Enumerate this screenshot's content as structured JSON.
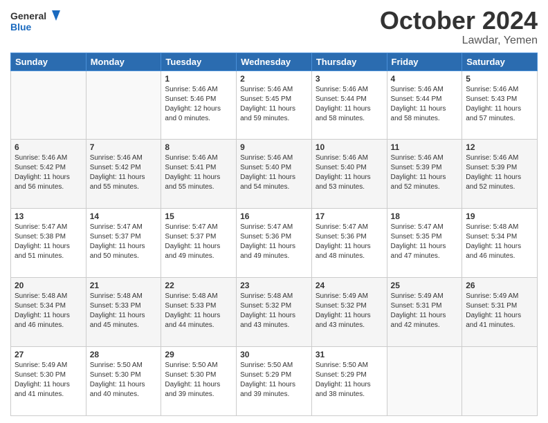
{
  "header": {
    "logo": {
      "general": "General",
      "blue": "Blue"
    },
    "title": "October 2024",
    "location": "Lawdar, Yemen"
  },
  "weekdays": [
    "Sunday",
    "Monday",
    "Tuesday",
    "Wednesday",
    "Thursday",
    "Friday",
    "Saturday"
  ],
  "weeks": [
    [
      {
        "day": "",
        "sunrise": "",
        "sunset": "",
        "daylight": ""
      },
      {
        "day": "",
        "sunrise": "",
        "sunset": "",
        "daylight": ""
      },
      {
        "day": "1",
        "sunrise": "Sunrise: 5:46 AM",
        "sunset": "Sunset: 5:46 PM",
        "daylight": "Daylight: 12 hours and 0 minutes."
      },
      {
        "day": "2",
        "sunrise": "Sunrise: 5:46 AM",
        "sunset": "Sunset: 5:45 PM",
        "daylight": "Daylight: 11 hours and 59 minutes."
      },
      {
        "day": "3",
        "sunrise": "Sunrise: 5:46 AM",
        "sunset": "Sunset: 5:44 PM",
        "daylight": "Daylight: 11 hours and 58 minutes."
      },
      {
        "day": "4",
        "sunrise": "Sunrise: 5:46 AM",
        "sunset": "Sunset: 5:44 PM",
        "daylight": "Daylight: 11 hours and 58 minutes."
      },
      {
        "day": "5",
        "sunrise": "Sunrise: 5:46 AM",
        "sunset": "Sunset: 5:43 PM",
        "daylight": "Daylight: 11 hours and 57 minutes."
      }
    ],
    [
      {
        "day": "6",
        "sunrise": "Sunrise: 5:46 AM",
        "sunset": "Sunset: 5:42 PM",
        "daylight": "Daylight: 11 hours and 56 minutes."
      },
      {
        "day": "7",
        "sunrise": "Sunrise: 5:46 AM",
        "sunset": "Sunset: 5:42 PM",
        "daylight": "Daylight: 11 hours and 55 minutes."
      },
      {
        "day": "8",
        "sunrise": "Sunrise: 5:46 AM",
        "sunset": "Sunset: 5:41 PM",
        "daylight": "Daylight: 11 hours and 55 minutes."
      },
      {
        "day": "9",
        "sunrise": "Sunrise: 5:46 AM",
        "sunset": "Sunset: 5:40 PM",
        "daylight": "Daylight: 11 hours and 54 minutes."
      },
      {
        "day": "10",
        "sunrise": "Sunrise: 5:46 AM",
        "sunset": "Sunset: 5:40 PM",
        "daylight": "Daylight: 11 hours and 53 minutes."
      },
      {
        "day": "11",
        "sunrise": "Sunrise: 5:46 AM",
        "sunset": "Sunset: 5:39 PM",
        "daylight": "Daylight: 11 hours and 52 minutes."
      },
      {
        "day": "12",
        "sunrise": "Sunrise: 5:46 AM",
        "sunset": "Sunset: 5:39 PM",
        "daylight": "Daylight: 11 hours and 52 minutes."
      }
    ],
    [
      {
        "day": "13",
        "sunrise": "Sunrise: 5:47 AM",
        "sunset": "Sunset: 5:38 PM",
        "daylight": "Daylight: 11 hours and 51 minutes."
      },
      {
        "day": "14",
        "sunrise": "Sunrise: 5:47 AM",
        "sunset": "Sunset: 5:37 PM",
        "daylight": "Daylight: 11 hours and 50 minutes."
      },
      {
        "day": "15",
        "sunrise": "Sunrise: 5:47 AM",
        "sunset": "Sunset: 5:37 PM",
        "daylight": "Daylight: 11 hours and 49 minutes."
      },
      {
        "day": "16",
        "sunrise": "Sunrise: 5:47 AM",
        "sunset": "Sunset: 5:36 PM",
        "daylight": "Daylight: 11 hours and 49 minutes."
      },
      {
        "day": "17",
        "sunrise": "Sunrise: 5:47 AM",
        "sunset": "Sunset: 5:36 PM",
        "daylight": "Daylight: 11 hours and 48 minutes."
      },
      {
        "day": "18",
        "sunrise": "Sunrise: 5:47 AM",
        "sunset": "Sunset: 5:35 PM",
        "daylight": "Daylight: 11 hours and 47 minutes."
      },
      {
        "day": "19",
        "sunrise": "Sunrise: 5:48 AM",
        "sunset": "Sunset: 5:34 PM",
        "daylight": "Daylight: 11 hours and 46 minutes."
      }
    ],
    [
      {
        "day": "20",
        "sunrise": "Sunrise: 5:48 AM",
        "sunset": "Sunset: 5:34 PM",
        "daylight": "Daylight: 11 hours and 46 minutes."
      },
      {
        "day": "21",
        "sunrise": "Sunrise: 5:48 AM",
        "sunset": "Sunset: 5:33 PM",
        "daylight": "Daylight: 11 hours and 45 minutes."
      },
      {
        "day": "22",
        "sunrise": "Sunrise: 5:48 AM",
        "sunset": "Sunset: 5:33 PM",
        "daylight": "Daylight: 11 hours and 44 minutes."
      },
      {
        "day": "23",
        "sunrise": "Sunrise: 5:48 AM",
        "sunset": "Sunset: 5:32 PM",
        "daylight": "Daylight: 11 hours and 43 minutes."
      },
      {
        "day": "24",
        "sunrise": "Sunrise: 5:49 AM",
        "sunset": "Sunset: 5:32 PM",
        "daylight": "Daylight: 11 hours and 43 minutes."
      },
      {
        "day": "25",
        "sunrise": "Sunrise: 5:49 AM",
        "sunset": "Sunset: 5:31 PM",
        "daylight": "Daylight: 11 hours and 42 minutes."
      },
      {
        "day": "26",
        "sunrise": "Sunrise: 5:49 AM",
        "sunset": "Sunset: 5:31 PM",
        "daylight": "Daylight: 11 hours and 41 minutes."
      }
    ],
    [
      {
        "day": "27",
        "sunrise": "Sunrise: 5:49 AM",
        "sunset": "Sunset: 5:30 PM",
        "daylight": "Daylight: 11 hours and 41 minutes."
      },
      {
        "day": "28",
        "sunrise": "Sunrise: 5:50 AM",
        "sunset": "Sunset: 5:30 PM",
        "daylight": "Daylight: 11 hours and 40 minutes."
      },
      {
        "day": "29",
        "sunrise": "Sunrise: 5:50 AM",
        "sunset": "Sunset: 5:30 PM",
        "daylight": "Daylight: 11 hours and 39 minutes."
      },
      {
        "day": "30",
        "sunrise": "Sunrise: 5:50 AM",
        "sunset": "Sunset: 5:29 PM",
        "daylight": "Daylight: 11 hours and 39 minutes."
      },
      {
        "day": "31",
        "sunrise": "Sunrise: 5:50 AM",
        "sunset": "Sunset: 5:29 PM",
        "daylight": "Daylight: 11 hours and 38 minutes."
      },
      {
        "day": "",
        "sunrise": "",
        "sunset": "",
        "daylight": ""
      },
      {
        "day": "",
        "sunrise": "",
        "sunset": "",
        "daylight": ""
      }
    ]
  ]
}
